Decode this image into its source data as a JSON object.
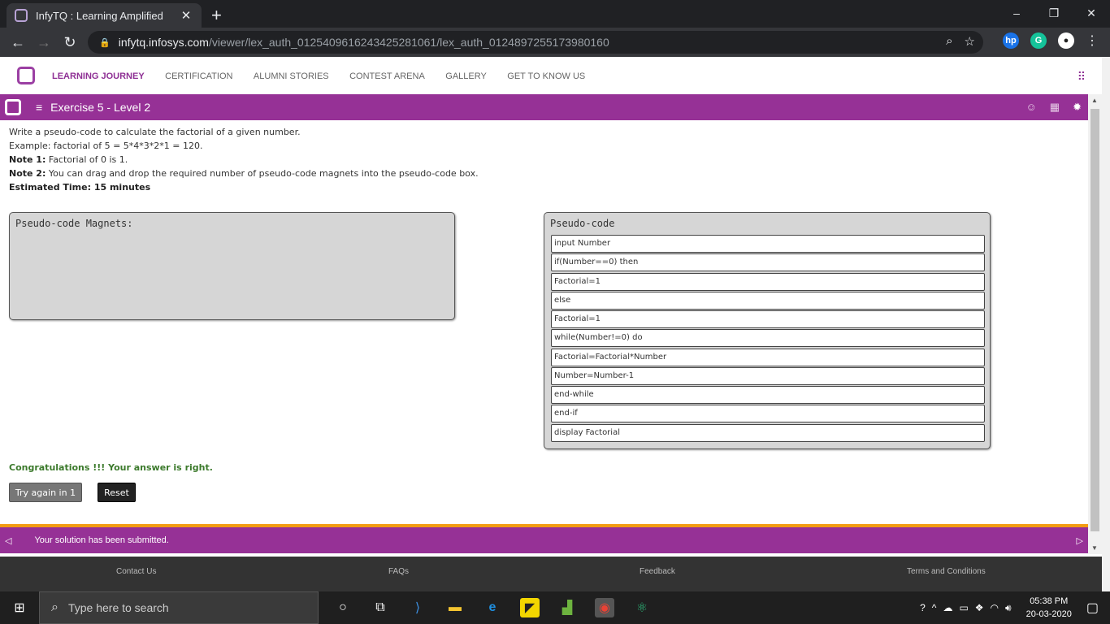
{
  "browser": {
    "tab_title": "InfyTQ : Learning Amplified",
    "tab_close": "✕",
    "new_tab": "+",
    "url_host": "infytq.infosys.com",
    "url_path": "/viewer/lex_auth_012540961624342528106​1/lex_auth_012489725517398016​0",
    "window_controls": [
      "–",
      "❐",
      "✕"
    ]
  },
  "site_menu": {
    "items": [
      "LEARNING JOURNEY",
      "CERTIFICATION",
      "ALUMNI STORIES",
      "CONTEST ARENA",
      "GALLERY",
      "GET TO KNOW US"
    ]
  },
  "exercise": {
    "title": "Exercise 5 - Level 2",
    "prompt": "Write a pseudo-code to calculate the factorial of a given number.",
    "example": "Example: factorial of 5 = 5*4*3*2*1 = 120.",
    "note1_label": "Note 1:",
    "note1_text": " Factorial of 0 is 1.",
    "note2_label": "Note 2:",
    "note2_text": " You can drag and drop the required number of pseudo-code magnets into the pseudo-code box.",
    "estimated": "Estimated Time: 15 minutes"
  },
  "magnets_panel": {
    "title": "Pseudo-code Magnets:"
  },
  "pseudo_panel": {
    "title": "Pseudo-code",
    "lines": [
      "input Number",
      "if(Number==0) then",
      "Factorial=1",
      "else",
      "Factorial=1",
      "while(Number!=0) do",
      "Factorial=Factorial*Number",
      "Number=Number-1",
      "end-while",
      "end-if",
      "display Factorial"
    ]
  },
  "result": {
    "message": "Congratulations !!! Your answer is right.",
    "try_again": "Try again in 1",
    "reset": "Reset"
  },
  "submitted_bar": {
    "text": "Your solution has been submitted."
  },
  "footer": {
    "links": [
      "Contact Us",
      "FAQs",
      "Feedback",
      "Terms and Conditions"
    ]
  },
  "taskbar": {
    "search_placeholder": "Type here to search",
    "time": "05:38 PM",
    "date": "20-03-2020"
  },
  "colors": {
    "brand_purple": "#963196",
    "accent_orange": "#f39c12",
    "success_green": "#3c7a2c"
  }
}
